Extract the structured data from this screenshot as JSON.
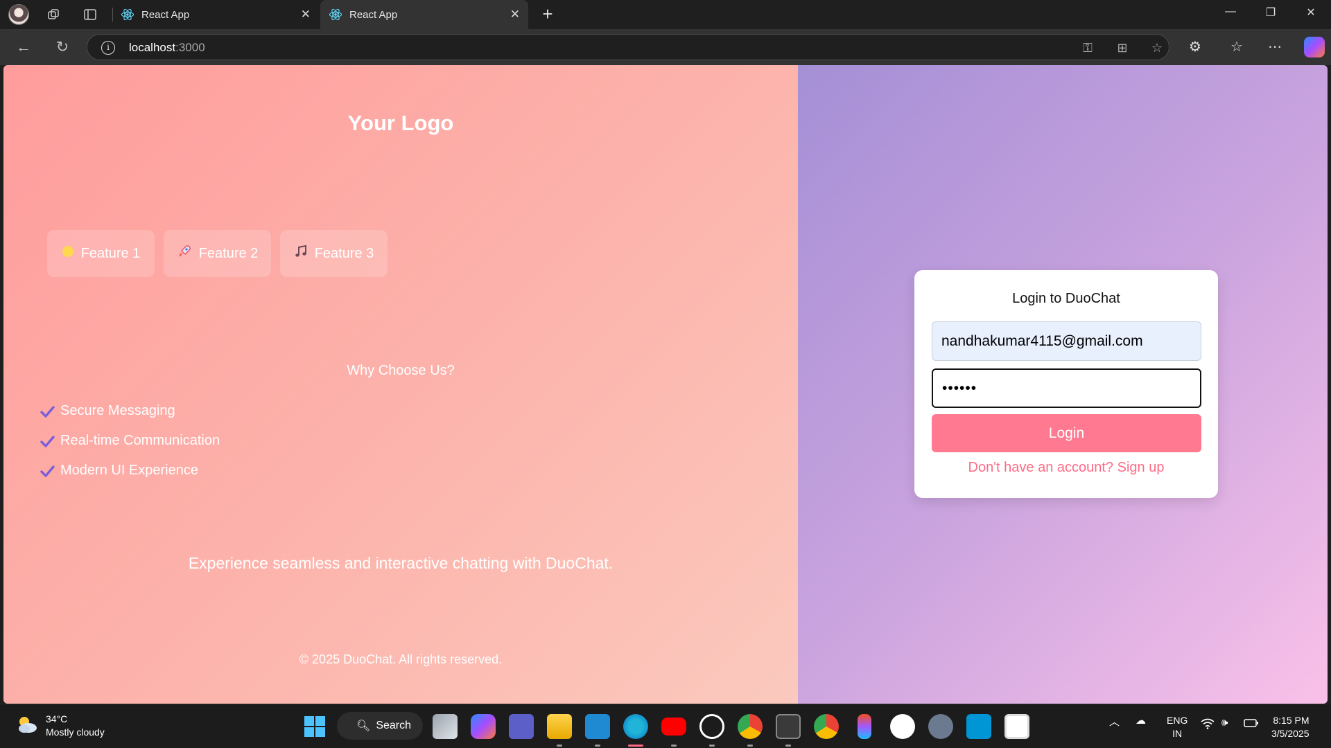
{
  "browser": {
    "tabs": [
      {
        "title": "React App",
        "active": false
      },
      {
        "title": "React App",
        "active": true
      }
    ],
    "address": {
      "host": "localhost",
      "port": ":3000"
    }
  },
  "page": {
    "logo": "Your Logo",
    "features": [
      {
        "icon": "sun-icon",
        "label": "Feature 1"
      },
      {
        "icon": "rocket-icon",
        "label": "Feature 2"
      },
      {
        "icon": "music-note-icon",
        "label": "Feature 3"
      }
    ],
    "why_title": "Why Choose Us?",
    "why_items": [
      "Secure Messaging",
      "Real-time Communication",
      "Modern UI Experience"
    ],
    "tagline": "Experience seamless and interactive chatting with DuoChat.",
    "copyright": "© 2025 DuoChat. All rights reserved.",
    "login": {
      "title": "Login to DuoChat",
      "email_value": "nandhakumar4115@gmail.com",
      "password_value": "••••••",
      "button": "Login",
      "signup_link": "Don't have an account? Sign up"
    },
    "colors": {
      "accent": "#ff7a90",
      "link": "#ff6b85",
      "check": "#7b5fd6"
    }
  },
  "taskbar": {
    "weather": {
      "temp": "34°C",
      "condition": "Mostly cloudy"
    },
    "search": "Search",
    "language": {
      "line1": "ENG",
      "line2": "IN"
    },
    "time": "8:15 PM",
    "date": "3/5/2025"
  }
}
